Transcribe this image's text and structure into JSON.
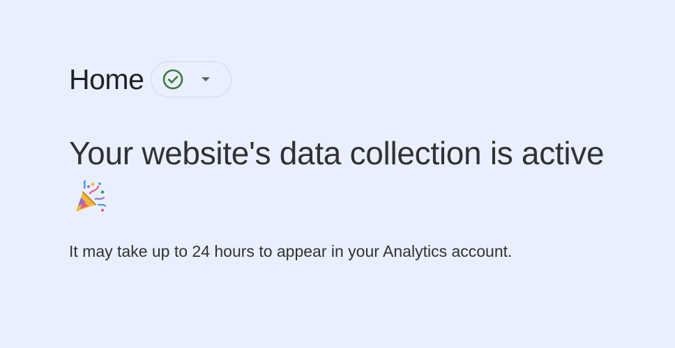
{
  "header": {
    "title": "Home",
    "status_chip": {
      "icon": "check-circle-icon",
      "dropdown_icon": "caret-down-icon",
      "status_color": "#3c7a3e"
    }
  },
  "main": {
    "headline": "Your website's data collection is active",
    "headline_icon": "party-popper-icon",
    "subtext": "It may take up to 24 hours to appear in your Analytics account."
  },
  "colors": {
    "background": "#e9effc",
    "text": "#303134",
    "chip_border": "#d3d8e2"
  }
}
